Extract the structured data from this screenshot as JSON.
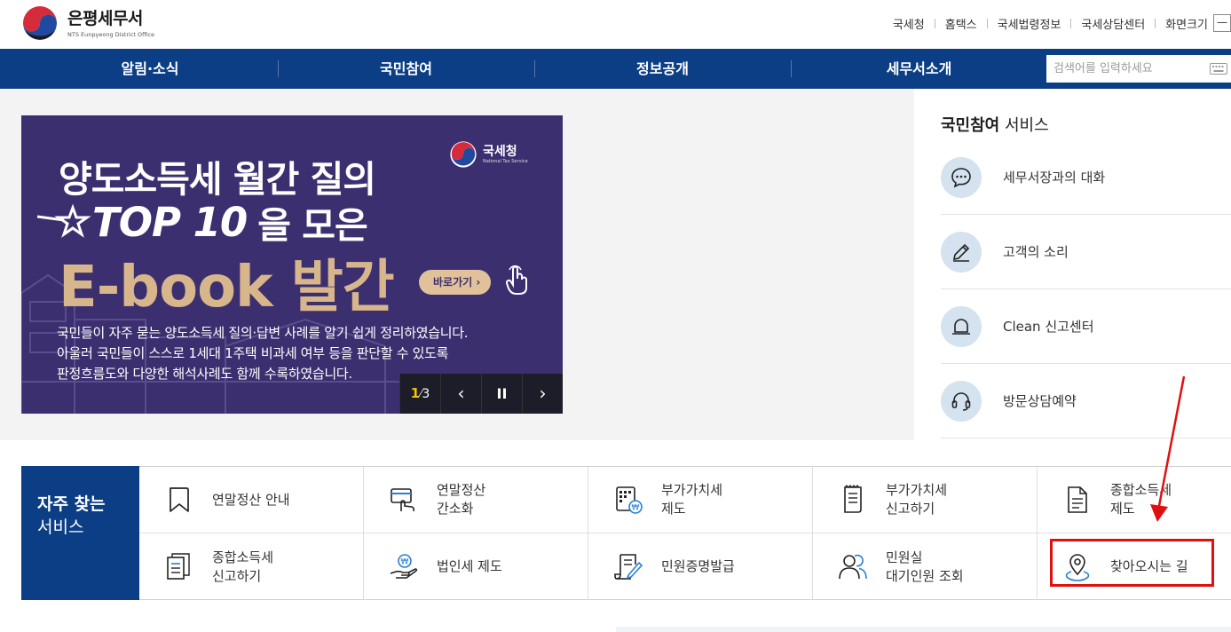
{
  "header": {
    "logo_ko": "은평세무서",
    "logo_en": "NTS Eunpyeong District Office",
    "util_links": [
      "국세청",
      "홈택스",
      "국세법령정보",
      "국세상담센터",
      "화면크기"
    ],
    "zoom_minus": "—"
  },
  "gnb": {
    "items": [
      "알림·소식",
      "국민참여",
      "정보공개",
      "세무서소개"
    ],
    "search_placeholder": "검색어를 입력하세요"
  },
  "banner": {
    "logo_ko": "국세청",
    "logo_en": "National Tax Service",
    "line1": "양도소득세 월간 질의",
    "line2_top": "TOP 10",
    "line2_rest": "을 모은",
    "line3": "E-book 발간",
    "go_button": "바로가기  ›",
    "desc": [
      "국민들이 자주 묻는 양도소득세 질의·답변 사례를 알기 쉽게 정리하였습니다.",
      "아울러 국민들이 스스로 1세대 1주택 비과세 여부 등을 판단할 수 있도록",
      "판정흐름도와 다양한 해석사례도 함께 수록하였습니다."
    ],
    "page_current": "1",
    "page_total": "3",
    "prev": "‹",
    "pause": "II",
    "next": "›"
  },
  "service": {
    "title_bold": "국민참여",
    "title_rest": " 서비스",
    "items": [
      {
        "label": "세무서장과의 대화",
        "icon": "chat-icon"
      },
      {
        "label": "고객의 소리",
        "icon": "pencil-icon"
      },
      {
        "label": "Clean 신고센터",
        "icon": "bell-icon"
      },
      {
        "label": "방문상담예약",
        "icon": "headset-icon"
      }
    ]
  },
  "frequent": {
    "head_l1": "자주 찾는",
    "head_l2": "서비스",
    "items": [
      {
        "label": "연말정산 안내",
        "icon": "bookmark-icon"
      },
      {
        "label": "연말정산\n간소화",
        "icon": "card-hand-icon"
      },
      {
        "label": "부가가치세\n제도",
        "icon": "calculator-won-icon"
      },
      {
        "label": "부가가치세\n신고하기",
        "icon": "receipt-icon"
      },
      {
        "label": "종합소득세\n제도",
        "icon": "document-icon"
      },
      {
        "label": "종합소득세\n신고하기",
        "icon": "documents-icon"
      },
      {
        "label": "법인세 제도",
        "icon": "coin-hand-icon"
      },
      {
        "label": "민원증명발급",
        "icon": "certificate-icon"
      },
      {
        "label": "민원실\n대기인원 조회",
        "icon": "people-icon"
      },
      {
        "label": "찾아오시는 길",
        "icon": "map-pin-icon"
      }
    ]
  },
  "colors": {
    "primary": "#0b3e84",
    "banner_bg": "#3c2f70",
    "banner_gold": "#d8b68c",
    "highlight": "#e01010"
  }
}
